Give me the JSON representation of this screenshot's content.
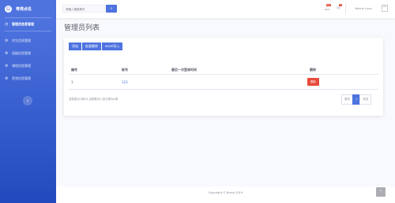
{
  "sidebar": {
    "brand": "粤荷点名",
    "brand_icon": "smile-icon",
    "items": [
      {
        "label": "管理员信息管理",
        "icon": "dashboard-icon",
        "active": true
      },
      {
        "label": "学生信息管理",
        "icon": "gear-icon"
      },
      {
        "label": "班级信息管理",
        "icon": "gear-icon"
      },
      {
        "label": "课程信息管理",
        "icon": "gear-icon"
      },
      {
        "label": "签到信息管理",
        "icon": "gear-icon"
      }
    ],
    "toggle_icon": "chevron-left-icon"
  },
  "topbar": {
    "search_placeholder": "请输入搜索条件",
    "bell_count": "3+",
    "mail_count": "7",
    "user_name": "Valerie Luna",
    "avatar_alt": "user"
  },
  "page_title": "管理员列表",
  "toolbar": {
    "add_label": "添加",
    "batch_delete_label": "批量删除",
    "excel_import_label": "excel导入"
  },
  "table": {
    "headers": [
      "编号",
      "账号",
      "最后一次登录时间",
      "删除"
    ],
    "rows": [
      {
        "id": "1",
        "account": "123",
        "last_login": "",
        "delete_label": "删除"
      }
    ]
  },
  "pagination": {
    "info": "当前显示1到10,当前数为1,总记录为1条",
    "first": "首页",
    "current": "1",
    "last": "末页"
  },
  "footer": {
    "copyright": "Copyright © Brand 2019"
  },
  "colors": {
    "primary": "#4e73df",
    "danger": "#e74a3b"
  }
}
